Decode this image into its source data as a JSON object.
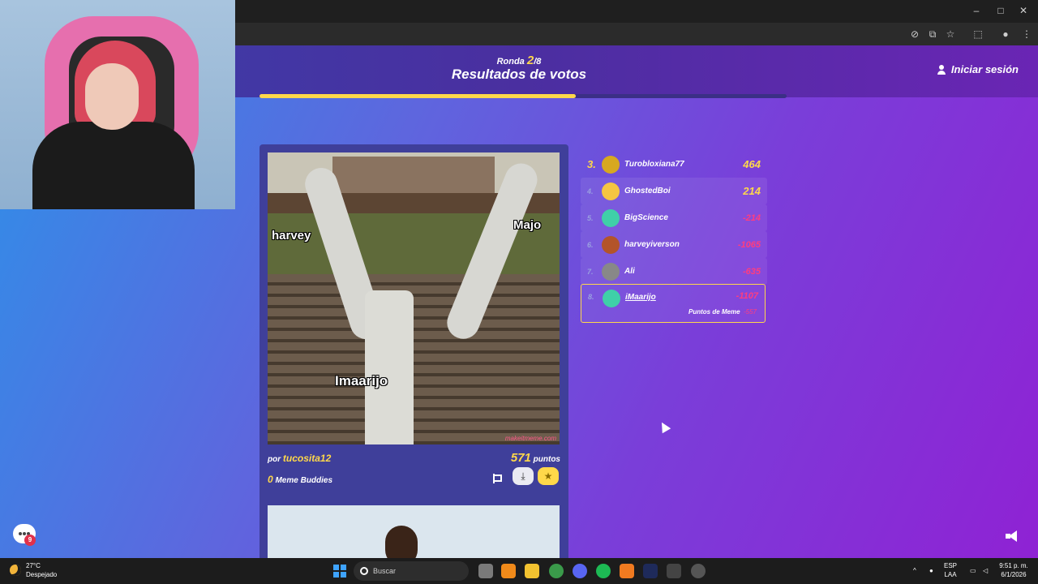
{
  "game": {
    "round_prefix": "Ronda",
    "round_current": "2",
    "round_total": "/8",
    "title": "Resultados de votos",
    "login_label": "Iniciar sesión",
    "round_progress": 0.6
  },
  "meme": {
    "labels": {
      "harvey": "harvey",
      "majo": "Majo",
      "imaarijo": "Imaarijo"
    },
    "watermark": "makeitmeme.com",
    "by_prefix": "por",
    "author": "tucosita12",
    "points": "571",
    "points_label": "puntos",
    "buddies_count": "0",
    "buddies_label": "Meme Buddies"
  },
  "leaderboard": [
    {
      "rank": "3.",
      "name": "Turobloxiana77",
      "score": "464",
      "negative": false,
      "avatar_color": "#d7a820"
    },
    {
      "rank": "4.",
      "name": "GhostedBoi",
      "score": "214",
      "negative": false,
      "avatar_color": "#f5c542"
    },
    {
      "rank": "5.",
      "name": "BigScience",
      "score": "-214",
      "negative": true,
      "avatar_color": "#3fd0a8"
    },
    {
      "rank": "6.",
      "name": "harveyiverson",
      "score": "-1065",
      "negative": true,
      "avatar_color": "#b3542a"
    },
    {
      "rank": "7.",
      "name": "Ali",
      "score": "-635",
      "negative": true,
      "avatar_color": "#888888"
    }
  ],
  "me": {
    "rank": "8.",
    "name": "iMaarijo",
    "score": "-1107",
    "meme_points_label": "Puntos de Meme",
    "meme_points": "-557",
    "avatar_color": "#3fd0a8"
  },
  "chat": {
    "badge": "9"
  },
  "taskbar": {
    "temp": "27°C",
    "weather": "Despejado",
    "search_placeholder": "Buscar",
    "lang": "ESP",
    "lang2": "LAA",
    "time": "9:51 p. m.",
    "date": "6/1/2026"
  }
}
